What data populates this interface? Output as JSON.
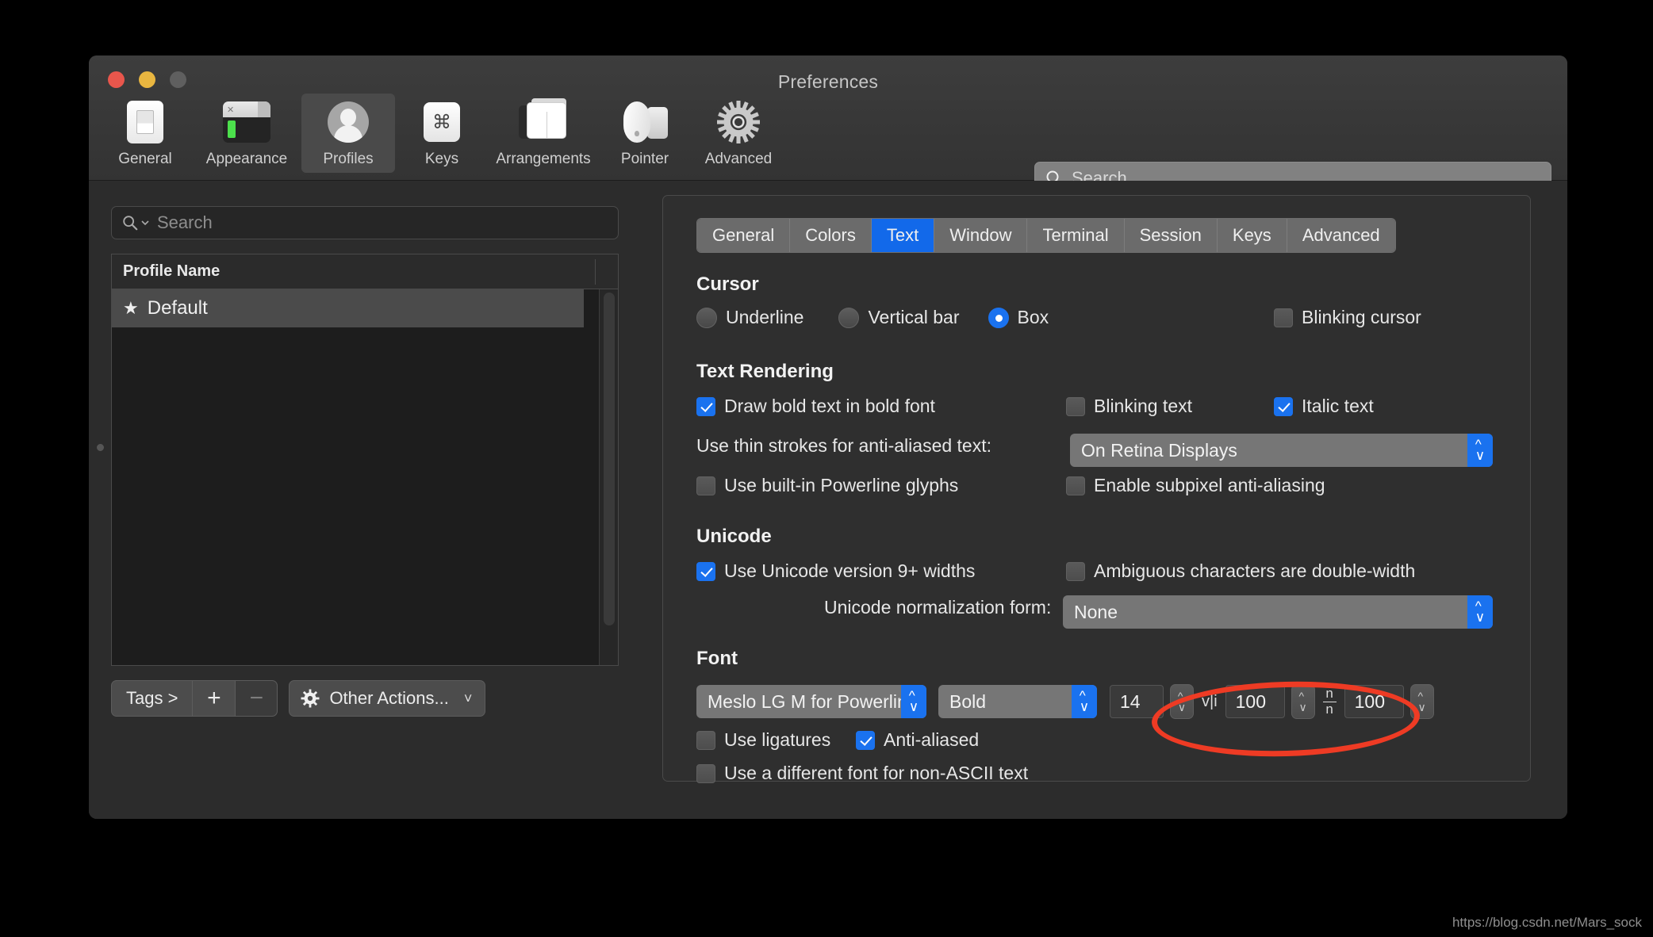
{
  "window": {
    "title": "Preferences",
    "traffic_lights": [
      "close-red",
      "minimize-yellow",
      "zoom-gray"
    ]
  },
  "toolbar": {
    "items": [
      {
        "label": "General",
        "icon": "general-icon",
        "selected": false
      },
      {
        "label": "Appearance",
        "icon": "appearance-icon",
        "selected": false
      },
      {
        "label": "Profiles",
        "icon": "profiles-icon",
        "selected": true
      },
      {
        "label": "Keys",
        "icon": "keys-icon",
        "selected": false
      },
      {
        "label": "Arrangements",
        "icon": "arrangements-icon",
        "selected": false
      },
      {
        "label": "Pointer",
        "icon": "pointer-icon",
        "selected": false
      },
      {
        "label": "Advanced",
        "icon": "advanced-icon",
        "selected": false
      }
    ],
    "search_placeholder": "Search"
  },
  "sidebar": {
    "search_placeholder": "Search",
    "table": {
      "column_header": "Profile Name",
      "rows": [
        {
          "star": "★",
          "name": "Default",
          "selected": true
        }
      ]
    },
    "buttons": {
      "tags": "Tags >",
      "add": "+",
      "remove": "−",
      "other_actions": "Other Actions...",
      "other_actions_icon": "gear-icon",
      "chevron": "˅"
    }
  },
  "tabs": [
    {
      "label": "General",
      "active": false
    },
    {
      "label": "Colors",
      "active": false
    },
    {
      "label": "Text",
      "active": true
    },
    {
      "label": "Window",
      "active": false
    },
    {
      "label": "Terminal",
      "active": false
    },
    {
      "label": "Session",
      "active": false
    },
    {
      "label": "Keys",
      "active": false
    },
    {
      "label": "Advanced",
      "active": false
    }
  ],
  "sections": {
    "cursor": {
      "title": "Cursor",
      "radios": [
        {
          "label": "Underline",
          "checked": false
        },
        {
          "label": "Vertical bar",
          "checked": false
        },
        {
          "label": "Box",
          "checked": true
        }
      ],
      "blinking_cursor": {
        "label": "Blinking cursor",
        "checked": false
      }
    },
    "text_rendering": {
      "title": "Text Rendering",
      "draw_bold": {
        "label": "Draw bold text in bold font",
        "checked": true
      },
      "blinking": {
        "label": "Blinking text",
        "checked": false
      },
      "italic": {
        "label": "Italic text",
        "checked": true
      },
      "thin_strokes_label": "Use thin strokes for anti-aliased text:",
      "thin_strokes_value": "On Retina Displays",
      "powerline": {
        "label": "Use built-in Powerline glyphs",
        "checked": false
      },
      "subpixel": {
        "label": "Enable subpixel anti-aliasing",
        "checked": false
      }
    },
    "unicode": {
      "title": "Unicode",
      "v9_widths": {
        "label": "Use Unicode version 9+ widths",
        "checked": true
      },
      "ambiguous": {
        "label": "Ambiguous characters are double-width",
        "checked": false
      },
      "normalization_label": "Unicode normalization form:",
      "normalization_value": "None"
    },
    "font": {
      "title": "Font",
      "family": "Meslo LG M for Powerline",
      "weight": "Bold",
      "size": "14",
      "horizontal_spacing": "100",
      "horizontal_spacing_icon": "v|i",
      "vertical_spacing": "100",
      "vertical_spacing_icon_top": "n",
      "vertical_spacing_icon_bottom": "n",
      "ligatures": {
        "label": "Use ligatures",
        "checked": false
      },
      "anti_aliased": {
        "label": "Anti-aliased",
        "checked": true
      },
      "non_ascii": {
        "label": "Use a different font for non-ASCII text",
        "checked": false
      }
    }
  },
  "annotation": {
    "shape": "ellipse",
    "color": "#ee3b24",
    "targets": "font-family-popup"
  },
  "watermark": "https://blog.csdn.net/Mars_sock",
  "colors": {
    "accent": "#1a72ef",
    "tab_active": "#1269ea",
    "window_bg": "#2d2d2d",
    "annotation_red": "#ee3b24"
  }
}
